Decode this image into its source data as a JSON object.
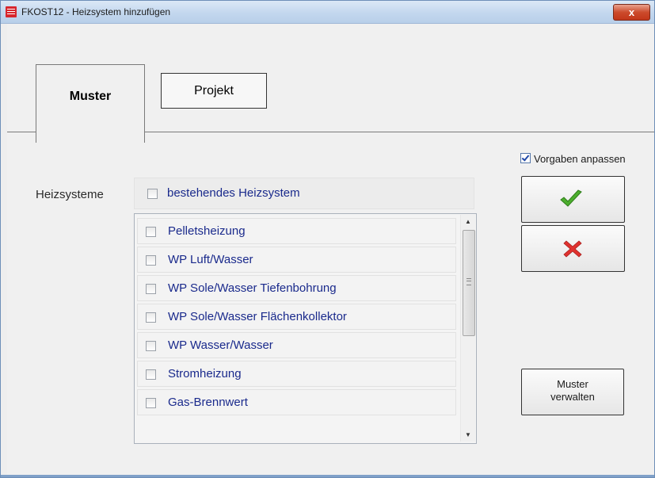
{
  "window": {
    "title": "FKOST12 - Heizsystem hinzufügen",
    "close_label": "x"
  },
  "tabs": [
    {
      "label": "Muster",
      "active": true
    },
    {
      "label": "Projekt",
      "active": false
    }
  ],
  "heizsysteme_label": "Heizsysteme",
  "existing_system": {
    "label": "bestehendes Heizsystem",
    "checked": false
  },
  "heating_list": [
    {
      "label": "Pelletsheizung",
      "checked": false
    },
    {
      "label": "WP Luft/Wasser",
      "checked": false
    },
    {
      "label": "WP Sole/Wasser Tiefenbohrung",
      "checked": false
    },
    {
      "label": "WP Sole/Wasser Flächenkollektor",
      "checked": false
    },
    {
      "label": "WP Wasser/Wasser",
      "checked": false
    },
    {
      "label": "Stromheizung",
      "checked": false
    },
    {
      "label": "Gas-Brennwert",
      "checked": false
    }
  ],
  "vorgaben": {
    "label": "Vorgaben anpassen",
    "checked": true
  },
  "buttons": {
    "ok_icon": "check-icon",
    "cancel_icon": "x-icon",
    "muster_line1": "Muster",
    "muster_line2": "verwalten"
  },
  "colors": {
    "list_text": "#1a2a8c",
    "ok_green": "#4cae2e",
    "cancel_red": "#e0322f"
  }
}
